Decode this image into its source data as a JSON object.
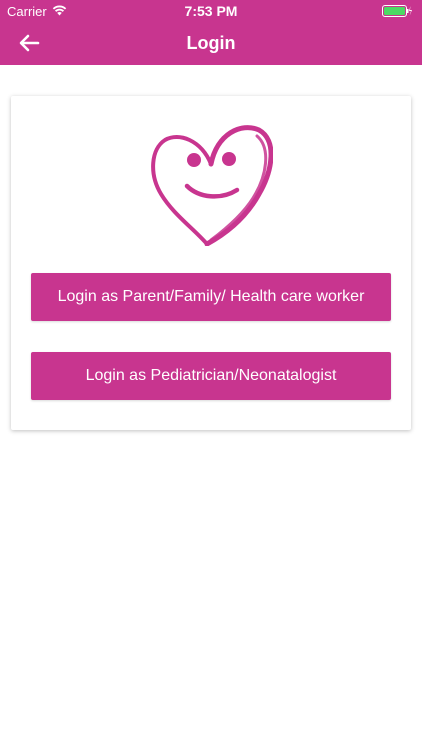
{
  "status_bar": {
    "carrier": "Carrier",
    "time": "7:53 PM",
    "wifi_icon": "wifi-icon",
    "battery_icon": "battery-charging-icon"
  },
  "nav": {
    "back_icon": "arrow-left-icon",
    "title": "Login"
  },
  "card": {
    "logo_icon": "smiling-heart-logo",
    "buttons": {
      "parent_label": "Login as Parent/Family/ Health care worker",
      "doctor_label": "Login as Pediatrician/Neonatalogist"
    }
  },
  "colors": {
    "brand": "#c8358f",
    "background": "#ffffff",
    "text_on_brand": "#ffffff"
  }
}
